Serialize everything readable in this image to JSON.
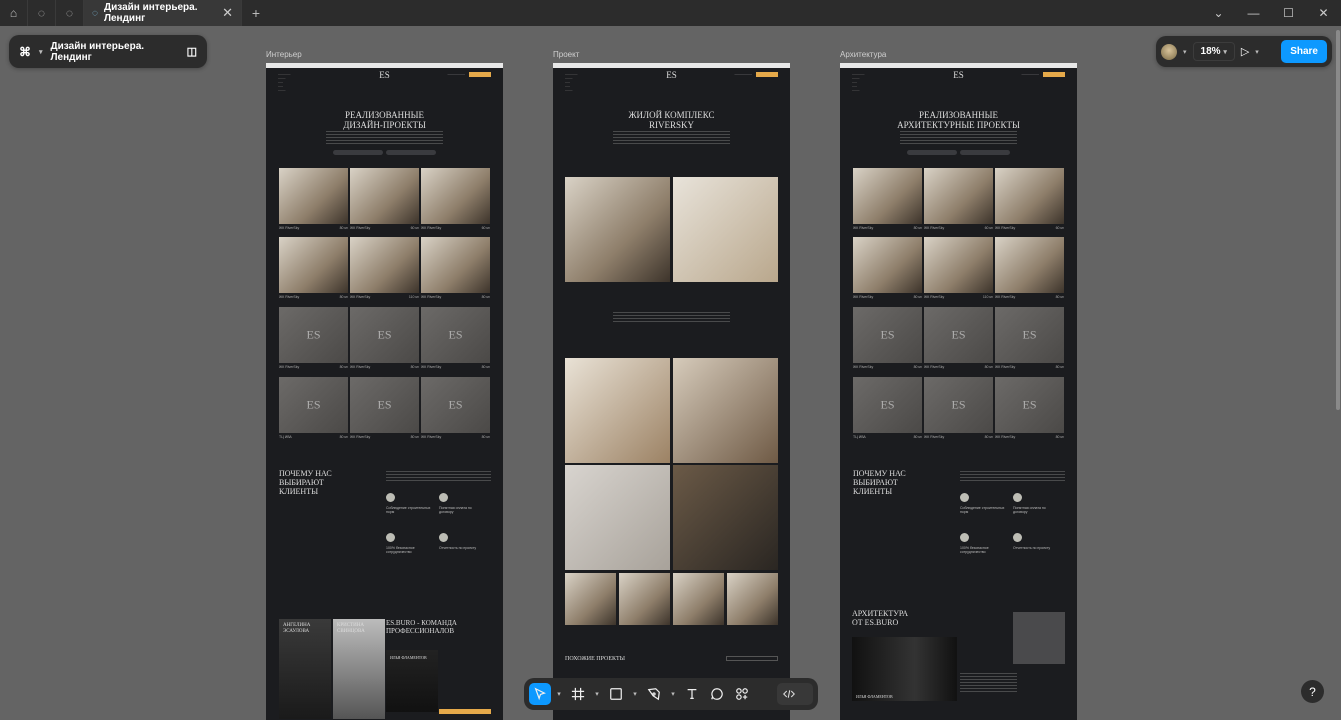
{
  "tabs": {
    "home_icon": "home-icon",
    "file_icon": "figma-file-icon",
    "active_title": "Дизайн интерьера. Лендинг"
  },
  "file": {
    "name": "Дизайн интерьера. Лендинг"
  },
  "view": {
    "zoom": "18%",
    "share": "Share"
  },
  "frames": [
    {
      "label": "Интерьер",
      "title": [
        "РЕАЛИЗОВАННЫЕ",
        "ДИЗАЙН-ПРОЕКТЫ"
      ],
      "why": [
        "ПОЧЕМУ НАС",
        "ВЫБИРАЮТ",
        "КЛИЕНТЫ"
      ],
      "features": [
        "Соблюдение строительных норм",
        "Понятная оплата по договору",
        "100% безопасное сотрудничество",
        "Отчетность по проекту"
      ],
      "team_title": [
        "ES.BURO - КОМАНДА",
        "ПРОФЕССИОНАЛОВ"
      ],
      "people": [
        [
          "АНГЕЛИНА",
          "ЭСАУЛОВА"
        ],
        [
          "КРИСТИНА",
          "СВИНЦОВА"
        ],
        [
          "ИЛЬЯ ФЛАМЕНТОВ"
        ]
      ]
    },
    {
      "label": "Проект",
      "title": [
        "ЖИЛОЙ КОМПЛЕКС",
        "RIVERSKY"
      ],
      "similar": "ПОХОЖИЕ ПРОЕКТЫ"
    },
    {
      "label": "Архитектура",
      "title": [
        "РЕАЛИЗОВАННЫЕ",
        "АРХИТЕКТУРНЫЕ ПРОЕКТЫ"
      ],
      "why": [
        "ПОЧЕМУ НАС",
        "ВЫБИРАЮТ",
        "КЛИЕНТЫ"
      ],
      "features": [
        "Соблюдение строительных норм",
        "Понятная оплата по договору",
        "100% безопасное сотрудничество",
        "Отчетность по проекту"
      ],
      "arch_title": [
        "АРХИТЕКТУРА",
        "ОТ ES.BURO"
      ],
      "person": "ИЛЬЯ ФЛАМЕНТОВ"
    }
  ],
  "grid": {
    "captions": [
      [
        "ЖК RiverSky",
        "80 м²"
      ],
      [
        "ЖК RiverSky",
        "60 м²"
      ],
      [
        "ЖК RiverSky",
        "60 м²"
      ],
      [
        "ЖК RiverSky",
        "80 м²"
      ],
      [
        "ЖК RiverSky",
        "110 м²"
      ],
      [
        "ЖК RiverSky",
        "80 м²"
      ],
      [
        "ЖК RiverSky",
        "80 м²"
      ],
      [
        "ЖК RiverSky",
        "80 м²"
      ],
      [
        "ЖК RiverSky",
        "80 м²"
      ],
      [
        "ТЦ ИВА",
        "80 м²"
      ],
      [
        "ЖК RiverSky",
        "80 м²"
      ],
      [
        "ЖК RiverSky",
        "80 м²"
      ]
    ]
  },
  "logo": "ES"
}
